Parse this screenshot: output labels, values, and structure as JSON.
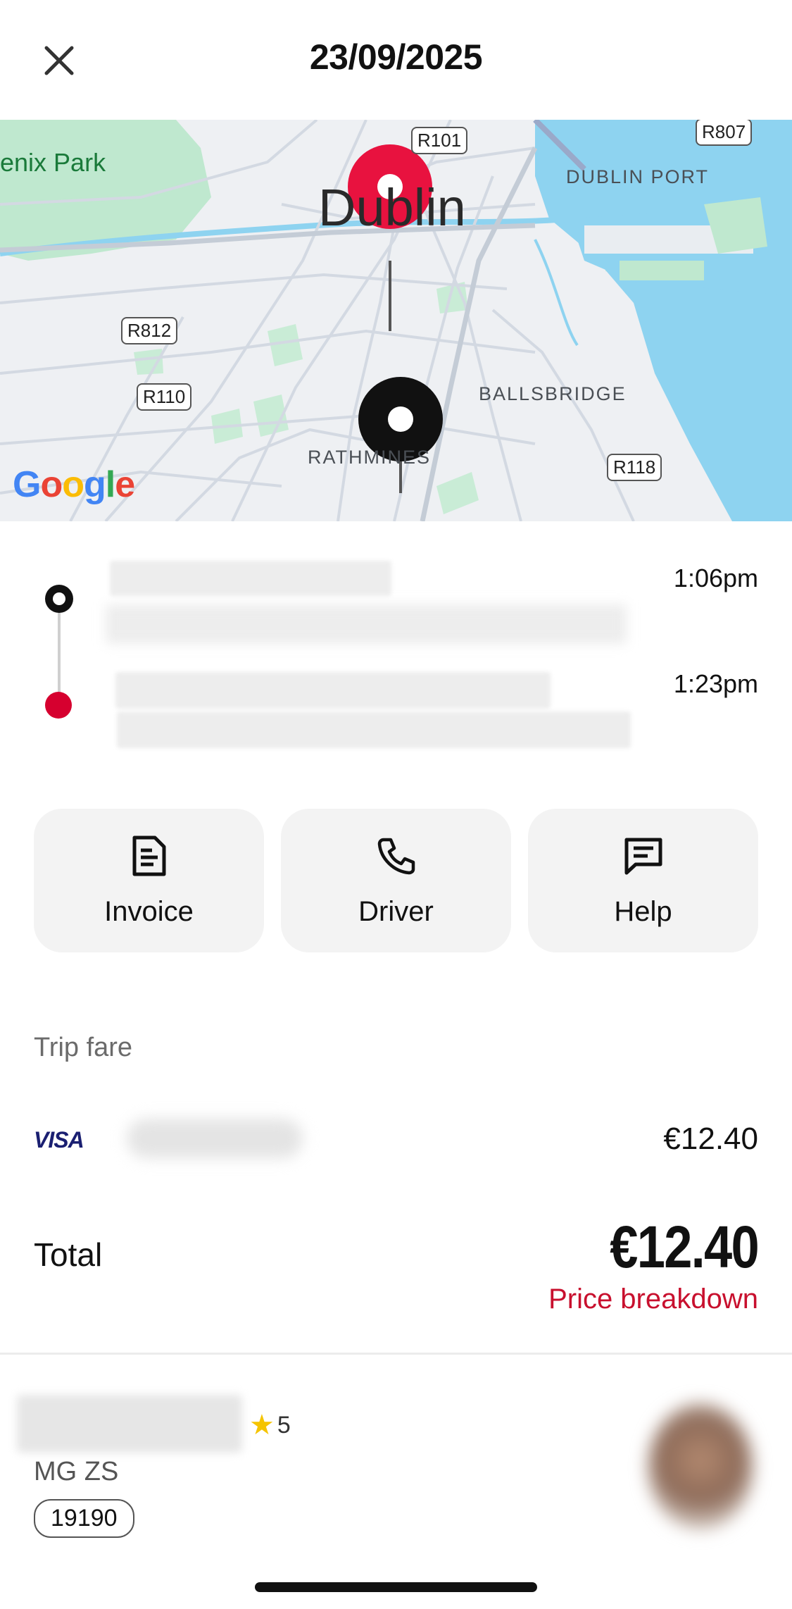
{
  "header": {
    "title": "23/09/2025"
  },
  "map": {
    "city_label": "Dublin",
    "park_label": "enix Park",
    "places": [
      "DUBLIN PORT",
      "BALLSBRIDGE",
      "RATHMINES"
    ],
    "roads": [
      "R101",
      "R807",
      "R812",
      "R110",
      "R118"
    ],
    "logo": "Google",
    "colors": {
      "pickup_pin": "#e8123f",
      "dropoff_pin": "#111111",
      "water": "#8ed3f0",
      "park": "#bfe8cf"
    }
  },
  "trip": {
    "pickup_time": "1:06pm",
    "dropoff_time": "1:23pm"
  },
  "actions": [
    {
      "label": "Invoice",
      "icon": "document-icon"
    },
    {
      "label": "Driver",
      "icon": "phone-icon"
    },
    {
      "label": "Help",
      "icon": "chat-icon"
    }
  ],
  "fare": {
    "section_title": "Trip fare",
    "card_brand": "VISA",
    "amount": "€12.40",
    "total_label": "Total",
    "total_amount": "€12.40",
    "breakdown_link": "Price breakdown",
    "accent_color": "#c8102e"
  },
  "driver": {
    "rating": "5",
    "car_model": "MG ZS",
    "plate": "19190"
  }
}
